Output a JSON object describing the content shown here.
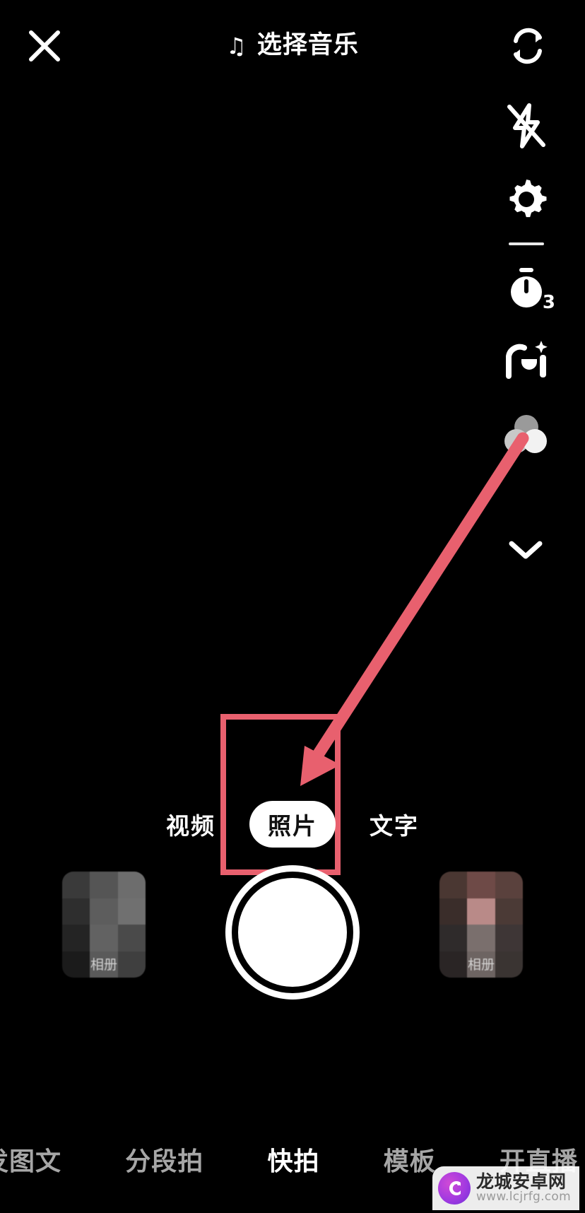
{
  "app": {
    "background_color": "#000000",
    "accent_annotation_color": "#e8606e"
  },
  "top_bar": {
    "close_label": "关闭",
    "music_note": "♫",
    "title": "选择音乐",
    "flip_label": "翻转镜头"
  },
  "right_rail": {
    "items": [
      {
        "name": "flash-off",
        "label": "闪光灯关闭"
      },
      {
        "name": "settings",
        "label": "设置"
      },
      {
        "name": "timer",
        "label": "倒计时",
        "badge": "3"
      },
      {
        "name": "beauty",
        "label": "美化"
      },
      {
        "name": "filters",
        "label": "滤镜"
      }
    ],
    "expand_label": "展开更多"
  },
  "modes": {
    "items": [
      {
        "label": "视频",
        "selected": false
      },
      {
        "label": "照片",
        "selected": true
      },
      {
        "label": "文字",
        "selected": false
      }
    ]
  },
  "capture": {
    "shutter_label": "拍摄",
    "left_thumb_label": "相册",
    "right_thumb_label": "相册"
  },
  "bottom_tabs": {
    "items": [
      {
        "label": "发图文",
        "active": false,
        "clipped": true
      },
      {
        "label": "分段拍",
        "active": false,
        "clipped": false
      },
      {
        "label": "快拍",
        "active": true,
        "clipped": false
      },
      {
        "label": "模板",
        "active": false,
        "clipped": false
      },
      {
        "label": "开直播",
        "active": false,
        "clipped": false
      }
    ]
  },
  "watermark": {
    "site_name": "龙城安卓网",
    "site_url": "www.lcjrfg.com"
  }
}
